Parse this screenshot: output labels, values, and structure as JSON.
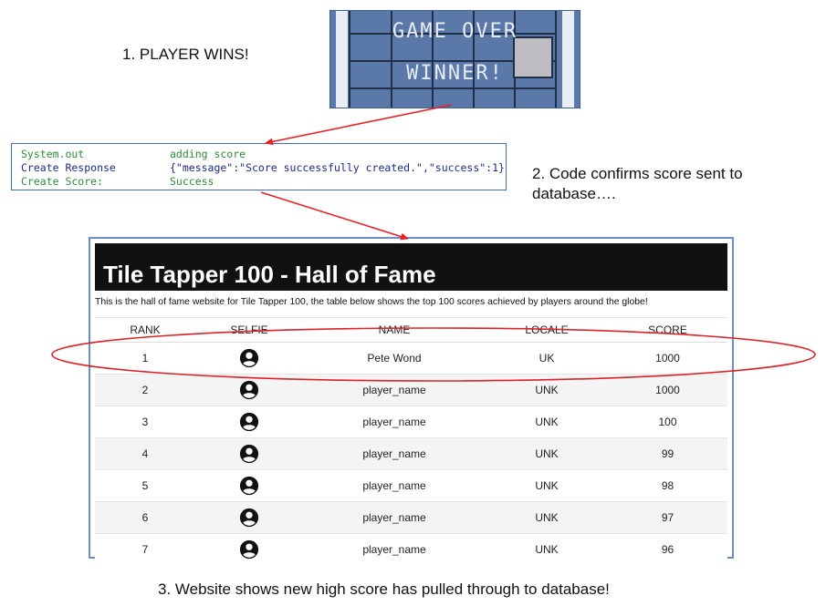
{
  "steps": {
    "step1": "1. PLAYER WINS!",
    "step2_line1": "2. Code confirms score sent to",
    "step2_line2": "database….",
    "step3": "3. Website shows new high score has pulled through to database!"
  },
  "game": {
    "line1": "GAME OVER",
    "line2": "WINNER!"
  },
  "code_log": [
    {
      "key": "System.out",
      "value": "adding score"
    },
    {
      "key": "Create Response",
      "value": "{\"message\":\"Score successfully created.\",\"success\":1}"
    },
    {
      "key": "Create Score:",
      "value": "Success"
    }
  ],
  "site": {
    "title": "Tile Tapper 100 - Hall of Fame",
    "intro": "This is the hall of fame website for Tile Tapper 100, the table below shows the top 100 scores achieved by players around the globe!",
    "columns": [
      "RANK",
      "SELFIE",
      "NAME",
      "LOCALE",
      "SCORE"
    ],
    "rows": [
      {
        "rank": "1",
        "selfie": "person-icon",
        "name": "Pete Wond",
        "locale": "UK",
        "score": "1000"
      },
      {
        "rank": "2",
        "selfie": "person-icon",
        "name": "player_name",
        "locale": "UNK",
        "score": "1000"
      },
      {
        "rank": "3",
        "selfie": "person-icon",
        "name": "player_name",
        "locale": "UNK",
        "score": "100"
      },
      {
        "rank": "4",
        "selfie": "person-icon",
        "name": "player_name",
        "locale": "UNK",
        "score": "99"
      },
      {
        "rank": "5",
        "selfie": "person-icon",
        "name": "player_name",
        "locale": "UNK",
        "score": "98"
      },
      {
        "rank": "6",
        "selfie": "person-icon",
        "name": "player_name",
        "locale": "UNK",
        "score": "97"
      },
      {
        "rank": "7",
        "selfie": "person-icon",
        "name": "player_name",
        "locale": "UNK",
        "score": "96"
      }
    ]
  },
  "colors": {
    "arrow": "#e8202a",
    "highlight_ellipse": "#d9232b",
    "frame_border": "#6b8fc5",
    "code_key": "#2e8b3a",
    "code_value_json": "#1b2c8a"
  }
}
